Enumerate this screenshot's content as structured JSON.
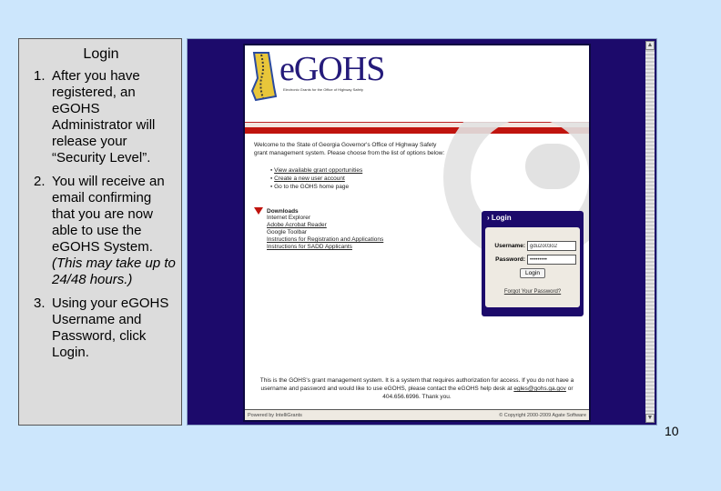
{
  "panel": {
    "title": "Login",
    "steps": [
      {
        "num": "1.",
        "text": "After you have registered, an eGOHS Administrator will release your “Security Level”."
      },
      {
        "num": "2.",
        "text": "You will receive an email confirming that you are now able to use the eGOHS System.",
        "note": "(This may take up to 24/48 hours.)"
      },
      {
        "num": "3.",
        "text": "Using your eGOHS Username and Password, click Login."
      }
    ]
  },
  "site": {
    "logo_text": "eGOHS",
    "logo_tagline": "Electronic Grants for the Office of Highway Safety",
    "welcome": "Welcome to the State of Georgia Governor's Office of Highway Safety grant management system. Please choose from the list of options below:",
    "links": [
      "View available grant opportunities",
      "Create a new user account",
      "Go to the GOHS home page"
    ],
    "downloads_title": "Downloads",
    "downloads": [
      "Internet Explorer",
      "Adobe Acrobat Reader",
      "Google Toolbar",
      "Instructions for Registration and Applications",
      "Instructions for SADD Applicants"
    ],
    "login": {
      "title": "Login",
      "username_label": "Username:",
      "username_value": "gdu2o03o2",
      "password_label": "Password:",
      "password_value": "•••••••••",
      "button": "Login",
      "forgot": "Forgot Your Password?"
    },
    "notice_pre": "This is the GOHS's grant management system. It is a system that requires authorization for access. If you do not have a username and password and would like to use eGOHS, please contact the eGOHS help desk at ",
    "notice_email": "egles@gohs.ga.gov",
    "notice_post": " or 404.656.6996. Thank you.",
    "footer_left": "Powered by IntelliGrants",
    "footer_right": "© Copyright 2000-2009 Agate Software"
  },
  "slide_number": "10"
}
